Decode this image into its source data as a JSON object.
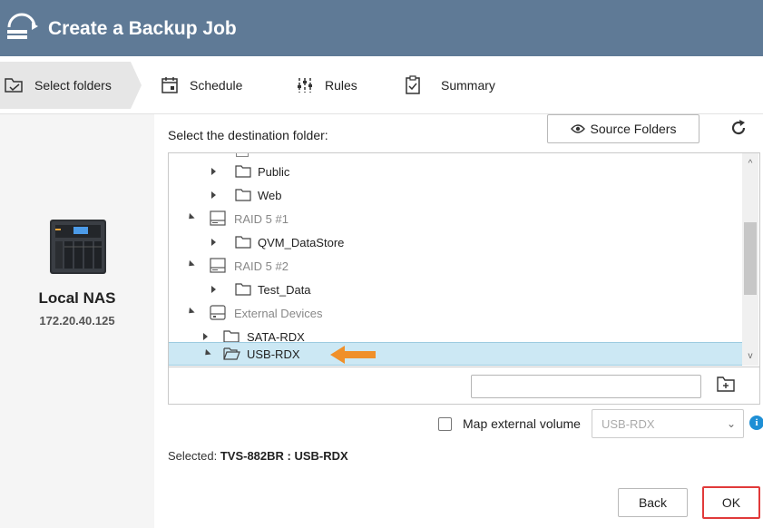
{
  "window": {
    "title": "Create a Backup Job"
  },
  "steps": [
    {
      "label": "Select folders",
      "icon": "folder-check-icon",
      "active": true
    },
    {
      "label": "Schedule",
      "icon": "calendar-icon",
      "active": false
    },
    {
      "label": "Rules",
      "icon": "sliders-icon",
      "active": false
    },
    {
      "label": "Summary",
      "icon": "clipboard-icon",
      "active": false
    }
  ],
  "source": {
    "name": "Local NAS",
    "ip": "172.20.40.125",
    "icon": "nas-device-icon"
  },
  "destination": {
    "label": "Select the destination folder:",
    "source_folders_button": "Source Folders",
    "refresh_icon": "refresh-icon",
    "tree": [
      {
        "label": "Public",
        "type": "folder",
        "expanded": false,
        "selected": false
      },
      {
        "label": "Web",
        "type": "folder",
        "expanded": false,
        "selected": false
      },
      {
        "label": "RAID 5 #1",
        "type": "volume",
        "expanded": true,
        "selected": false
      },
      {
        "label": "QVM_DataStore",
        "type": "folder",
        "expanded": false,
        "selected": false
      },
      {
        "label": "RAID 5 #2",
        "type": "volume",
        "expanded": true,
        "selected": false
      },
      {
        "label": "Test_Data",
        "type": "folder",
        "expanded": false,
        "selected": false
      },
      {
        "label": "External Devices",
        "type": "external",
        "expanded": true,
        "selected": false
      },
      {
        "label": "SATA-RDX",
        "type": "folder",
        "expanded": false,
        "selected": false
      },
      {
        "label": "USB-RDX",
        "type": "folder-open",
        "expanded": true,
        "selected": true
      }
    ],
    "new_folder": {
      "value": "",
      "placeholder": ""
    }
  },
  "map_external": {
    "label": "Map external volume",
    "checked": false,
    "selected_option": "USB-RDX"
  },
  "selection": {
    "prefix": "Selected:",
    "value": "TVS-882BR : USB-RDX"
  },
  "buttons": {
    "back": "Back",
    "ok": "OK"
  },
  "colors": {
    "titlebar": "#5f7a96",
    "selected_row": "#cce8f4",
    "highlight_arrow": "#f0902a",
    "ok_border": "#e13a3a",
    "info": "#1e8fd5"
  }
}
